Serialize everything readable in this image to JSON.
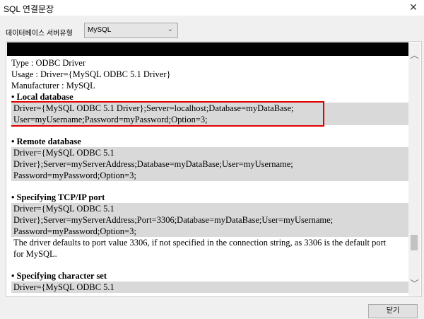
{
  "window": {
    "title": "SQL 연결문장",
    "close_symbol": "✕"
  },
  "server_type": {
    "label": "데이터베이스 서버유형",
    "selected": "MySQL",
    "chevron": "⌄"
  },
  "document": {
    "header_lines": [
      "Type : ODBC Driver",
      "Usage : Driver={MySQL ODBC 5.1 Driver}",
      "Manufacturer : MySQL"
    ],
    "sections": [
      {
        "heading": "• Local database",
        "code_lines": [
          "Driver={MySQL ODBC 5.1 Driver};Server=localhost;Database=myDataBase;",
          "User=myUsername;Password=myPassword;Option=3;"
        ],
        "highlighted": true
      },
      {
        "heading": "• Remote database",
        "code_lines": [
          "Driver={MySQL ODBC 5.1",
          "Driver};Server=myServerAddress;Database=myDataBase;User=myUsername;",
          "Password=myPassword;Option=3;"
        ]
      },
      {
        "heading": "• Specifying TCP/IP port",
        "code_lines": [
          "Driver={MySQL ODBC 5.1",
          "Driver};Server=myServerAddress;Port=3306;Database=myDataBase;User=myUsername;",
          "Password=myPassword;Option=3;"
        ],
        "note_lines": [
          "The driver defaults to port value 3306, if not specified in the connection string, as 3306 is the default port",
          "for MySQL."
        ]
      },
      {
        "heading": "• Specifying character set",
        "code_lines": [
          "Driver={MySQL ODBC 5.1"
        ]
      }
    ]
  },
  "scrollbar": {
    "up_symbol": "︿",
    "down_symbol": "﹀"
  },
  "footer": {
    "close_label": "닫기"
  }
}
